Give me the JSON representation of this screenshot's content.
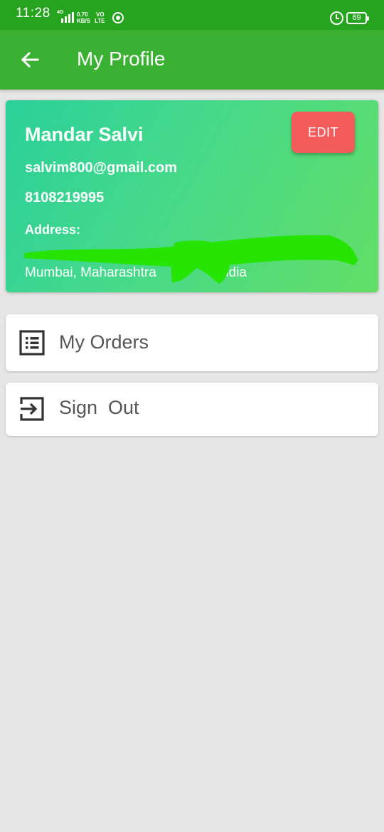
{
  "status_bar": {
    "time": "11:28",
    "network_top": "4G",
    "speed_value": "0.70",
    "speed_unit": "KB/S",
    "volte_top": "VO",
    "volte_bottom": "LTE",
    "battery": "69"
  },
  "app_bar": {
    "title": "My Profile",
    "back_icon": "arrow-left-icon"
  },
  "profile": {
    "name": "Mandar Salvi",
    "email": "salvim800@gmail.com",
    "phone": "8108219995",
    "address_label": "Address:",
    "address_line2_part1": "Mumbai, Maharashtra",
    "address_line2_part2": "India",
    "edit_label": "EDIT",
    "card_colors": [
      "#2ad09a",
      "#62de66"
    ],
    "edit_color": "#f45c5c"
  },
  "menu": {
    "orders_label": "My Orders",
    "orders_icon": "list-icon",
    "signout_label": "Sign  Out",
    "signout_icon": "exit-icon"
  },
  "colors": {
    "status_bar": "#26a31f",
    "app_bar": "#3bb134",
    "background": "#e6e6e6",
    "redaction": "#25e400"
  }
}
